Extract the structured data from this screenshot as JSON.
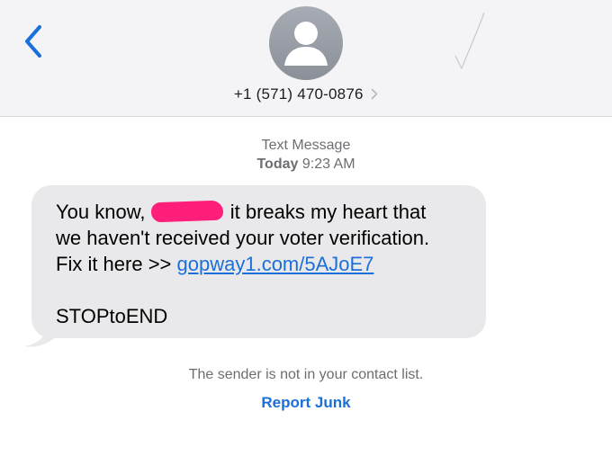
{
  "header": {
    "back_icon": "chevron-left-icon",
    "avatar_icon": "person-icon",
    "phone_number": "+1 (571) 470-0876",
    "disclosure_icon": "chevron-right-icon"
  },
  "conversation": {
    "service_label": "Text Message",
    "timestamp_day": "Today",
    "timestamp_time": "9:23 AM"
  },
  "message": {
    "text_before_name": "You know, ",
    "text_after_name": " it breaks my heart that\nwe haven't received your voter verification.\nFix it here >> ",
    "link": "gopway1.com/5AJoE7",
    "signoff": "STOPtoEND",
    "redaction_color": "#ff1f7a"
  },
  "footer": {
    "sender_note": "The sender is not in your contact list.",
    "report_junk_label": "Report Junk"
  },
  "colors": {
    "accent": "#1a6fd8",
    "bubble": "#e9e9eb",
    "header_bg": "#f4f4f6"
  }
}
